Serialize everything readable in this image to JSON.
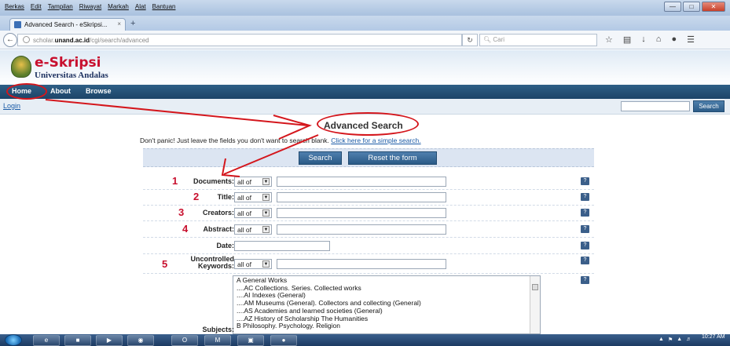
{
  "browser": {
    "menu": [
      "Berkas",
      "Edit",
      "Tampilan",
      "Riwayat",
      "Markah",
      "Alat",
      "Bantuan"
    ],
    "tab_title": "Advanced Search - eSkripsi...",
    "tab_close": "×",
    "new_tab": "+",
    "url_prefix": "scholar.",
    "url_domain": "unand.ac.id",
    "url_path": "/cgi/search/advanced",
    "search_placeholder": "Cari",
    "window_controls": [
      "—",
      "□",
      "✕"
    ]
  },
  "site": {
    "logo_title": "e-Skripsi",
    "logo_subtitle": "Universitas Andalas",
    "nav": [
      "Home",
      "About",
      "Browse"
    ],
    "login": "Login",
    "search_button": "Search"
  },
  "page": {
    "title": "Advanced Search",
    "intro_text": "Don't panic! Just leave the fields you don't want to search blank. ",
    "intro_link": "Click here for a simple search.",
    "search_button": "Search",
    "reset_button": "Reset the form",
    "fields": [
      {
        "label": "Documents:",
        "number": "1",
        "match": "all of"
      },
      {
        "label": "Title:",
        "number": "2",
        "match": "all of"
      },
      {
        "label": "Creators:",
        "number": "3",
        "match": "all of"
      },
      {
        "label": "Abstract:",
        "number": "4",
        "match": "all of"
      },
      {
        "label": "Date:",
        "number": "",
        "match": ""
      },
      {
        "label": "Uncontrolled Keywords:",
        "number": "5",
        "match": "all of"
      }
    ],
    "help_icon": "?",
    "subjects_label": "Subjects:",
    "subjects": [
      "A General Works",
      "....AC Collections. Series. Collected works",
      "....AI Indexes (General)",
      "....AM Museums (General). Collectors and collecting (General)",
      "....AS Academies and learned societies (General)",
      "....AZ History of Scholarship The Humanities",
      "B Philosophy. Psychology. Religion"
    ]
  },
  "taskbar": {
    "clock_time": "10:27 AM"
  },
  "annotation_color": "#d4161c"
}
